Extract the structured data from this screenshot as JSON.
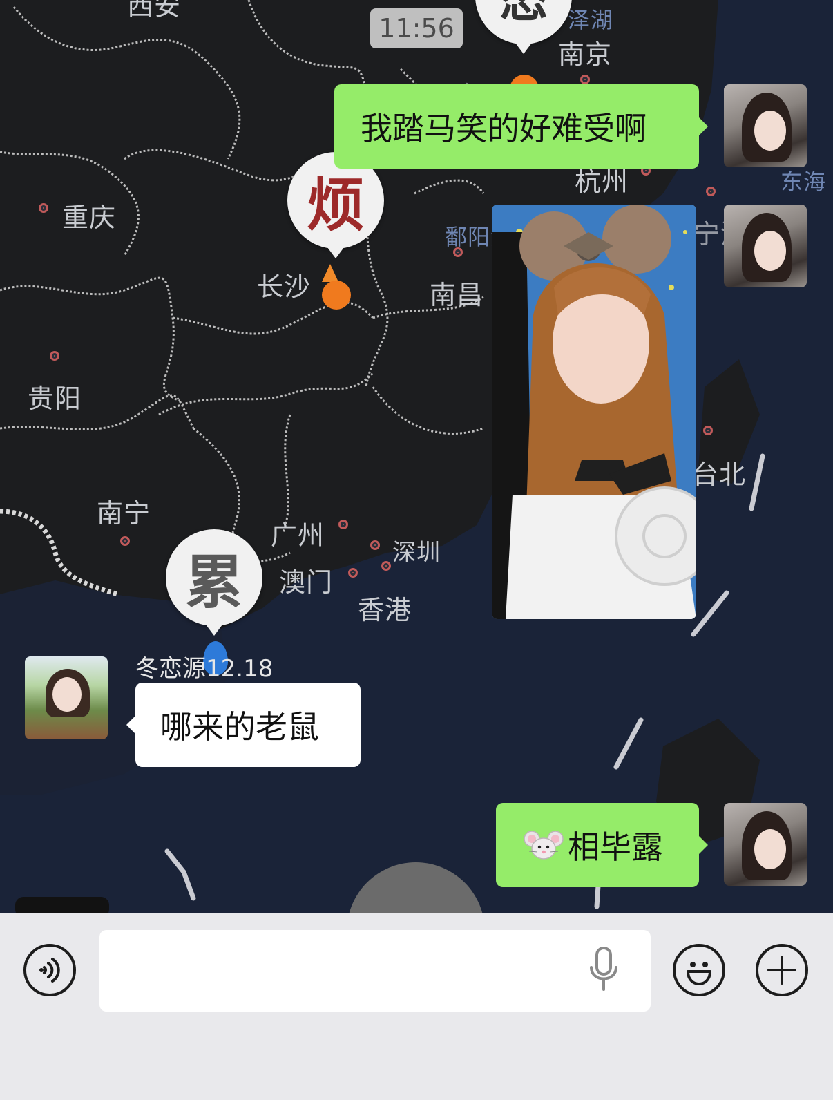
{
  "timestamp": "11:56",
  "map": {
    "cities": [
      {
        "id": "xian",
        "label": "西安"
      },
      {
        "id": "taihu",
        "label": "泽湖"
      },
      {
        "id": "nanjing",
        "label": "南京"
      },
      {
        "id": "hefei",
        "label": "合肥"
      },
      {
        "id": "hangzhou",
        "label": "杭州"
      },
      {
        "id": "donghai",
        "label": "东海"
      },
      {
        "id": "chongqing",
        "label": "重庆"
      },
      {
        "id": "poyang",
        "label": "鄱阳湖"
      },
      {
        "id": "ningbo",
        "label": "宁波"
      },
      {
        "id": "changsha",
        "label": "长沙"
      },
      {
        "id": "nanchang",
        "label": "南昌"
      },
      {
        "id": "guiyang",
        "label": "贵阳"
      },
      {
        "id": "taibei",
        "label": "台北"
      },
      {
        "id": "nanning",
        "label": "南宁"
      },
      {
        "id": "guangzhou",
        "label": "广州"
      },
      {
        "id": "shenzhen",
        "label": "深圳"
      },
      {
        "id": "aomen",
        "label": "澳门"
      },
      {
        "id": "xianggang",
        "label": "香港"
      }
    ],
    "markers": [
      {
        "id": "marker-top",
        "char": "怂"
      },
      {
        "id": "marker-fan",
        "char": "烦"
      },
      {
        "id": "marker-lei",
        "char": "累"
      }
    ]
  },
  "messages": [
    {
      "id": "m1",
      "side": "self",
      "type": "text",
      "text": "我踏马笑的好难受啊"
    },
    {
      "id": "m2",
      "side": "self",
      "type": "image"
    },
    {
      "id": "m3",
      "side": "other",
      "type": "text",
      "sender": "冬恋源12.18",
      "text": "哪来的老鼠"
    },
    {
      "id": "m4",
      "side": "self",
      "type": "text",
      "emoji": "mouse-face-emoji",
      "text": "相毕露"
    }
  ],
  "input_bar": {
    "voice_icon": "voice-icon",
    "placeholder": "",
    "value": "",
    "mic_icon": "microphone-icon",
    "emoji_icon": "smiley-icon",
    "plus_icon": "plus-icon"
  },
  "colors": {
    "self_bubble": "#95ec69",
    "other_bubble": "#ffffff",
    "map_land": "#1b1d20",
    "map_sea": "#1a2338",
    "input_bar_bg": "#e9e9ec"
  }
}
